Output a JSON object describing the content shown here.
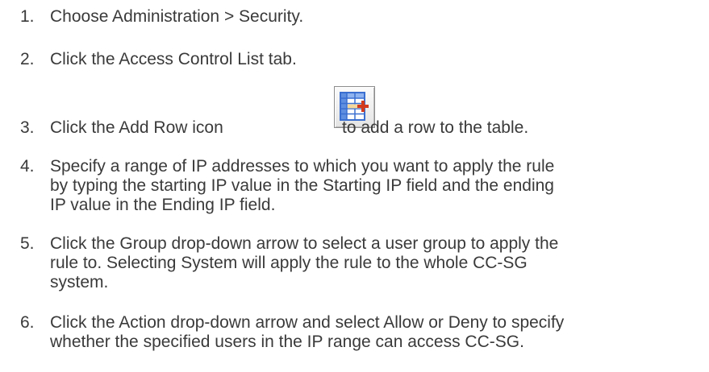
{
  "steps": [
    {
      "number": "1.",
      "lines": [
        "Choose Administration > Security."
      ]
    },
    {
      "number": "2.",
      "lines": [
        "Click the Access Control List tab."
      ]
    },
    {
      "number": "3.",
      "before_icon": "Click the Add Row icon",
      "after_icon": "to add a row to the table.",
      "icon": "add-row-icon"
    },
    {
      "number": "4.",
      "lines": [
        "Specify a range of IP addresses to which you want to apply the rule",
        "by typing the starting IP value in the Starting IP field and the ending",
        "IP value in the Ending IP field."
      ]
    },
    {
      "number": "5.",
      "lines": [
        "Click the Group drop-down arrow to select a user group to apply the",
        "rule to. Selecting System will apply the rule to the whole CC-SG",
        "system."
      ]
    },
    {
      "number": "6.",
      "lines": [
        "Click the Action drop-down arrow and select Allow or Deny to specify",
        "whether the specified users in the IP range can access CC-SG."
      ]
    }
  ],
  "colors": {
    "text": "#3a3a3a",
    "icon_border": "#8c8c8c",
    "icon_grid_blue": "#3a6fd0",
    "icon_plus_red": "#d23a1e"
  }
}
